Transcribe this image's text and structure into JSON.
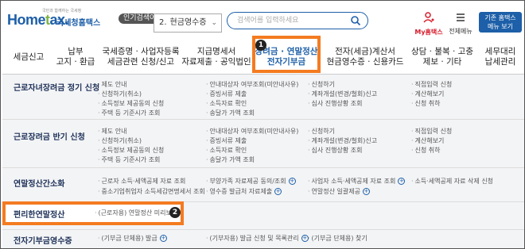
{
  "header": {
    "logo_tagline": "국민과 함께하는 국세청",
    "logo_text_1": "Home",
    "logo_text_sep": "t",
    "logo_text_2": "ax.",
    "logo_org": "국세청홈택스",
    "popular_badge": "인기검색어",
    "popular_rank": "2.",
    "popular_term": "현금영수증",
    "search_placeholder": "검색어를 입력하세요",
    "my_hometax_label": "My홈택스",
    "all_menu_label": "전체메뉴",
    "old_hometax_line1": "기존 홈택스",
    "old_hometax_line2": "메뉴 보기",
    "accent_color": "#1d5fa8",
    "highlight_color": "#f47b20"
  },
  "nav": {
    "items": [
      {
        "line1": "세금신고",
        "line2": ""
      },
      {
        "line1": "납부",
        "line2": "고지 · 환급"
      },
      {
        "line1": "국세증명 · 사업자등록",
        "line2": "세금관련 신청/신고"
      },
      {
        "line1": "지급명세서",
        "line2": "자료제출 · 공익법인"
      },
      {
        "line1": "장려금 · 연말정산",
        "line2": "전자기부금"
      },
      {
        "line1": "전자(세금)계산서",
        "line2": "현금영수증 · 신용카드"
      },
      {
        "line1": "상담 · 불복 · 고충",
        "line2": "제보 · 기타"
      },
      {
        "line1": "세무대리",
        "line2": "납세관리"
      }
    ],
    "active_index": 4,
    "marker_1": "1",
    "marker_2": "2"
  },
  "menu": {
    "rows": [
      {
        "label": "근로자녀장려금 정기 신청",
        "cols": [
          [
            "제도 안내",
            "신청하기(취소)",
            "소득정보 제공동의 신청",
            "주택 등 기준시가 조회"
          ],
          [
            "안내대상자 여부조회(미안내사유)",
            "증빙서류 제출",
            "소득자료 확인",
            "송달가 가액 조회"
          ],
          [
            "신청하기",
            "계좌개설(변경/철회)신고",
            "심사 진행상황 조회"
          ],
          [
            "직접입력 신청",
            "계산해보기",
            "신청 취하"
          ]
        ]
      },
      {
        "label": "근로장려금 반기 신청",
        "cols": [
          [
            "제도 안내",
            "신청하기(취소)",
            "소득정보 제공동의 신청",
            "주택 등 기준시가 조회"
          ],
          [
            "안내대상자 여부조회(미안내사유)",
            "증빙서류 제출",
            "소득자료 확인",
            "송달가 가액 조회"
          ],
          [
            "신청하기",
            "계좌개설(변경/철회)신고",
            "심사 진행상황 조회"
          ],
          [
            "직접입력 신청",
            "계산해보기",
            "신청 취하"
          ]
        ]
      },
      {
        "label": "연말정산간소화",
        "cols": [
          [
            "근로자 소득·세액공제 자료 조회",
            "중소기업취업자 소득세감면명세서 조회"
          ],
          [
            "부양가족 자료제공 동의/조회",
            "영수증 발급처 자료제출"
          ],
          [
            "사업자 소득·세액공제 자료 조회",
            "연말정산 일괄제공"
          ],
          [
            "소득·세액공제 자료 삭제 신청"
          ]
        ]
      },
      {
        "label": "편리한연말정산",
        "cols": [
          [
            "(근로자용) 연말정산 미리보기"
          ]
        ]
      },
      {
        "label": "전자기부금영수증",
        "cols": [
          [
            "(기부금 단체용) 발급"
          ],
          [
            "(기부자용) 발급 신청 및 목록관리"
          ],
          [
            "(기부금 단체용) 찾기"
          ]
        ]
      }
    ]
  }
}
